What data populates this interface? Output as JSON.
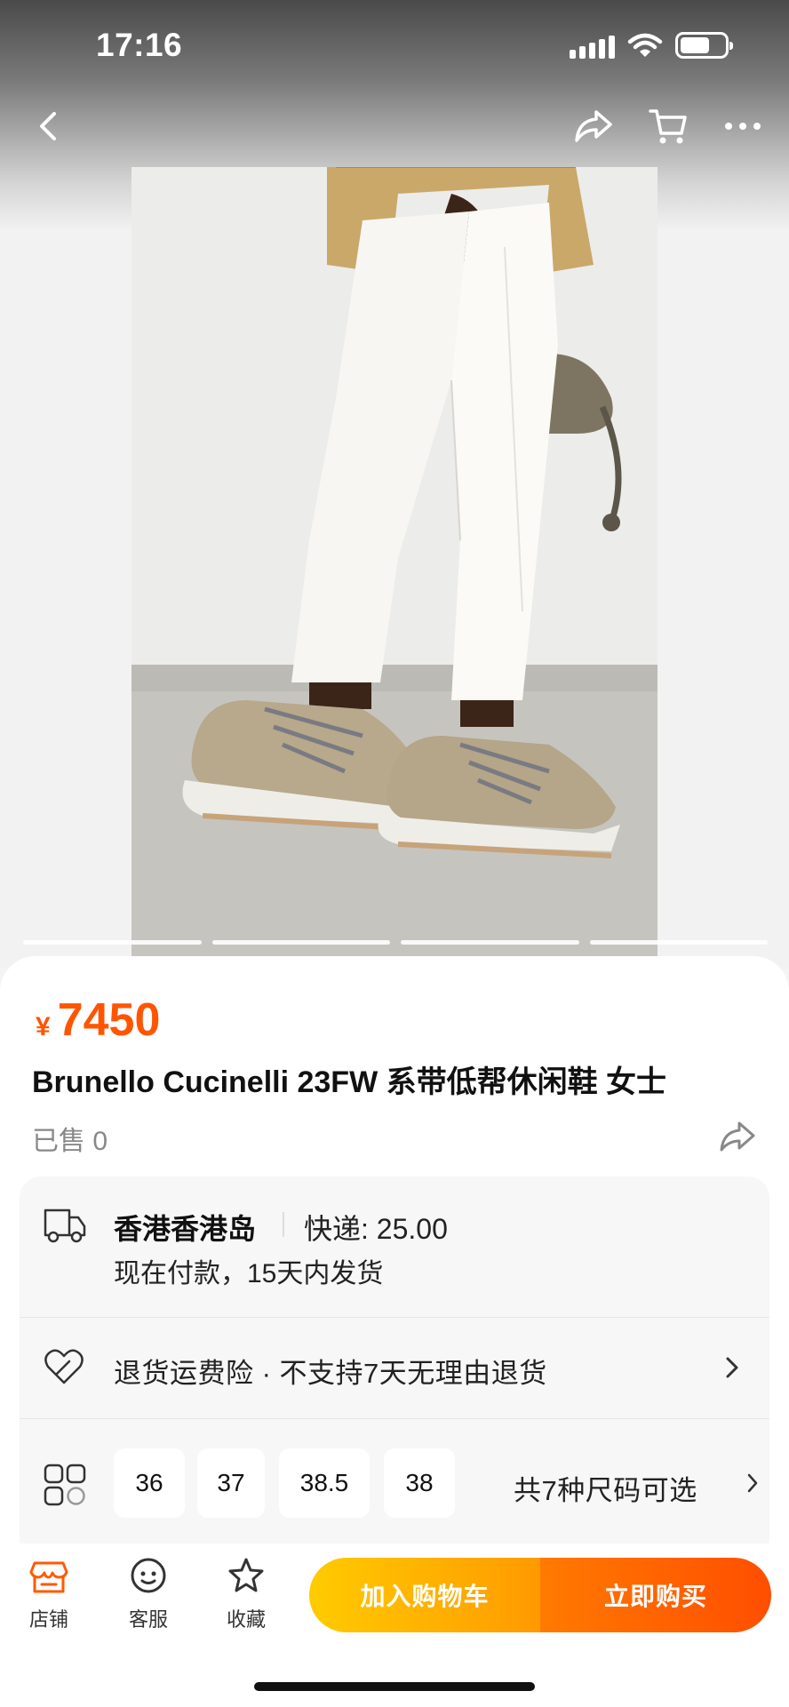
{
  "status_bar": {
    "time": "17:16",
    "battery_level": 0.66
  },
  "nav": {
    "back_icon": "chevron-left-icon",
    "share_icon": "share-icon",
    "cart_icon": "cart-icon",
    "more_icon": "more-icon"
  },
  "gallery": {
    "image_count": 4,
    "active_index": 0
  },
  "product": {
    "currency": "¥",
    "price": "7450",
    "title": "Brunello Cucinelli 23FW 系带低帮休闲鞋 女士",
    "sold": "已售 0"
  },
  "shipping": {
    "location": "香港香港岛",
    "fee": "快递: 25.00",
    "delivery_time": "现在付款，15天内发货"
  },
  "returns": {
    "text": "退货运费险 · 不支持7天无理由退货"
  },
  "sizes": {
    "options": [
      "36",
      "37",
      "38.5",
      "38"
    ],
    "more_label": "共7种尺码可选"
  },
  "bottom_bar": {
    "store_label": "店铺",
    "service_label": "客服",
    "favorite_label": "收藏",
    "add_to_cart": "加入购物车",
    "buy_now": "立即购买"
  },
  "colors": {
    "accent": "#ff5500",
    "cart_button": "#ffb300",
    "buy_button": "#ff5a00"
  }
}
